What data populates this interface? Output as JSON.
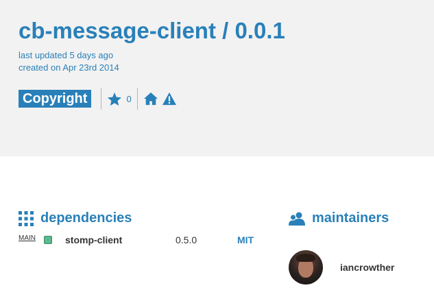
{
  "package": {
    "title": "cb-message-client / 0.0.1",
    "last_updated": "last updated 5 days ago",
    "created": "created on Apr 23rd 2014",
    "license_badge": "Copyright",
    "stars": "0"
  },
  "icons": {
    "star": "star-icon",
    "home": "home-icon",
    "issues": "warning-icon",
    "dependencies": "grid-icon",
    "maintainers": "users-icon"
  },
  "colors": {
    "accent": "#2980b9",
    "header_bg": "#f2f2f2",
    "dependency_status": "#5cb890"
  },
  "dependencies": {
    "heading": "dependencies",
    "items": [
      {
        "kind": "MAIN",
        "name": "stomp-client",
        "version": "0.5.0",
        "license": "MIT"
      }
    ]
  },
  "maintainers": {
    "heading": "maintainers",
    "items": [
      {
        "username": "iancrowther"
      }
    ]
  }
}
